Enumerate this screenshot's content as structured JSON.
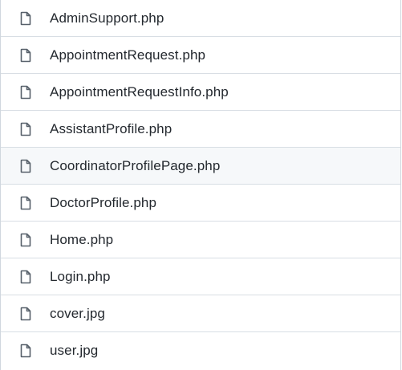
{
  "files": [
    {
      "name": "AdminSupport.php",
      "icon": "file-icon"
    },
    {
      "name": "AppointmentRequest.php",
      "icon": "file-icon"
    },
    {
      "name": "AppointmentRequestInfo.php",
      "icon": "file-icon"
    },
    {
      "name": "AssistantProfile.php",
      "icon": "file-icon"
    },
    {
      "name": "CoordinatorProfilePage.php",
      "icon": "file-icon",
      "hovered": true
    },
    {
      "name": "DoctorProfile.php",
      "icon": "file-icon"
    },
    {
      "name": "Home.php",
      "icon": "file-icon"
    },
    {
      "name": "Login.php",
      "icon": "file-icon"
    },
    {
      "name": "cover.jpg",
      "icon": "file-icon"
    },
    {
      "name": "user.jpg",
      "icon": "file-icon"
    }
  ],
  "colors": {
    "text": "#24292f",
    "icon": "#57606a",
    "hover_bg": "#f6f8fa",
    "border": "#d8dee4"
  }
}
